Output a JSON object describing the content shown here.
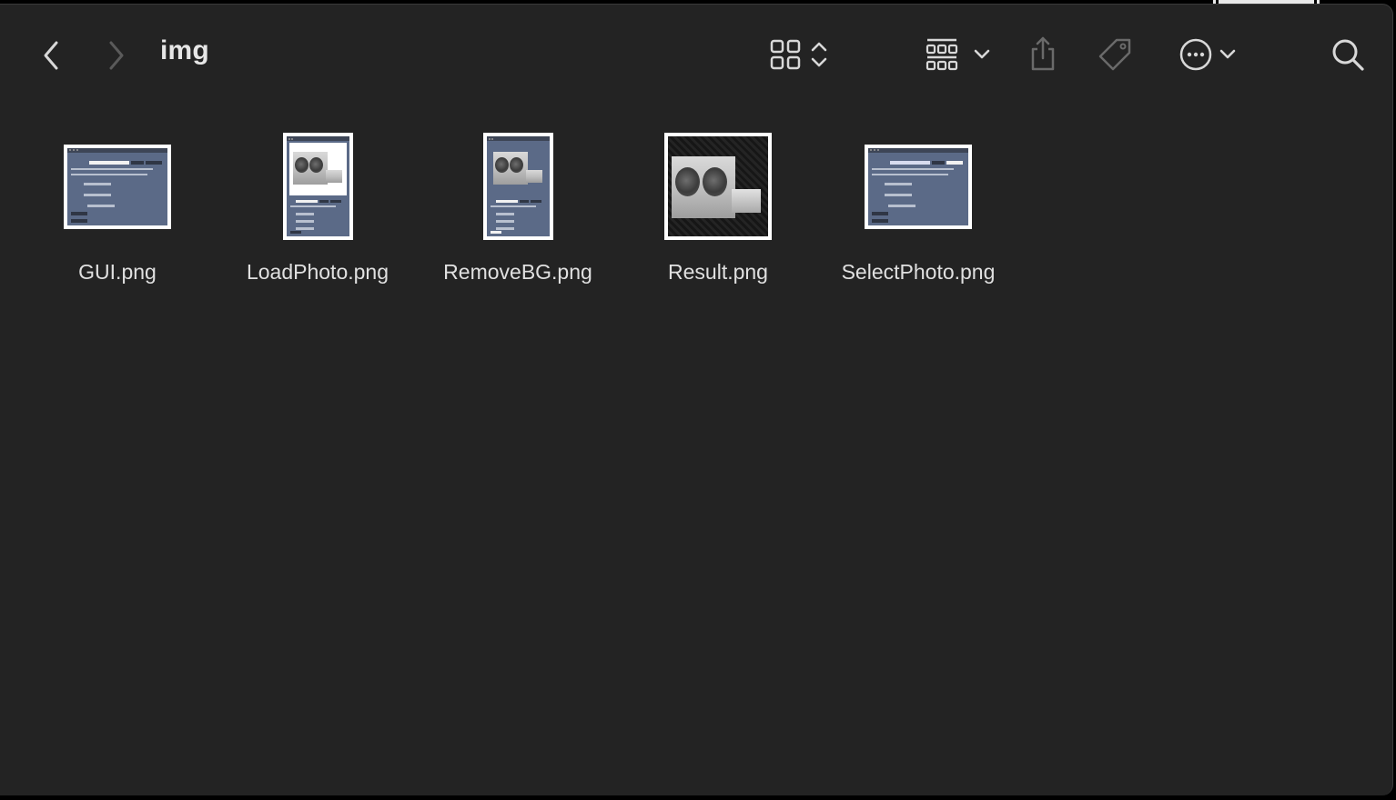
{
  "window": {
    "folder_title": "img"
  },
  "toolbar": {
    "icons": [
      "back-icon",
      "forward-icon",
      "grid-view-icon",
      "sort-updown-icon",
      "group-icon",
      "chevron-down-icon",
      "share-icon",
      "tag-icon",
      "more-icon",
      "chevron-down-icon",
      "search-icon"
    ]
  },
  "files": [
    {
      "name": "GUI.png"
    },
    {
      "name": "LoadPhoto.png"
    },
    {
      "name": "RemoveBG.png"
    },
    {
      "name": "Result.png"
    },
    {
      "name": "SelectPhoto.png"
    }
  ],
  "colors": {
    "window_bg": "#232323",
    "text": "#e0e0e0",
    "icon": "#d8d8d8",
    "icon_dim": "#6a6a6a"
  }
}
